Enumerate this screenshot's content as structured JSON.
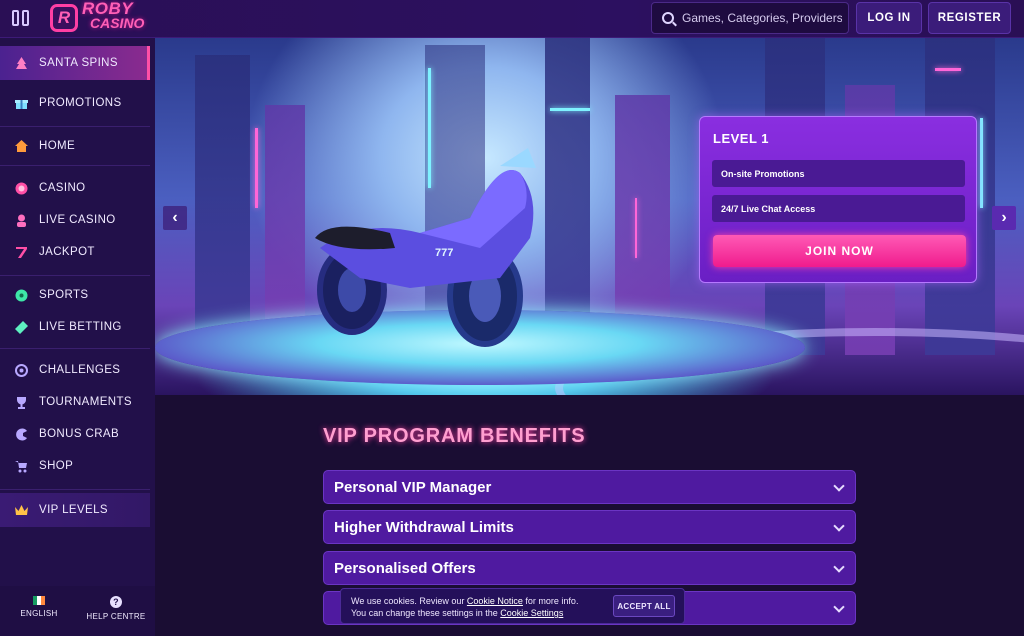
{
  "header": {
    "logo_main": "ROBY",
    "logo_sub": "CASINO",
    "logo_mark": "R",
    "search_placeholder": "Games, Categories, Providers",
    "login_label": "LOG IN",
    "register_label": "REGISTER"
  },
  "sidebar": {
    "items": [
      {
        "label": "SANTA SPINS",
        "icon": "christmas-tree-icon"
      },
      {
        "label": "PROMOTIONS",
        "icon": "gift-icon"
      },
      {
        "label": "HOME",
        "icon": "home-icon"
      },
      {
        "label": "CASINO",
        "icon": "chip-icon"
      },
      {
        "label": "LIVE CASINO",
        "icon": "dealer-icon"
      },
      {
        "label": "JACKPOT",
        "icon": "seven-icon"
      },
      {
        "label": "SPORTS",
        "icon": "football-icon"
      },
      {
        "label": "LIVE BETTING",
        "icon": "ticket-icon"
      },
      {
        "label": "CHALLENGES",
        "icon": "medal-icon"
      },
      {
        "label": "TOURNAMENTS",
        "icon": "trophy-icon"
      },
      {
        "label": "BONUS CRAB",
        "icon": "crab-icon"
      },
      {
        "label": "SHOP",
        "icon": "cart-icon"
      },
      {
        "label": "VIP LEVELS",
        "icon": "crown-icon"
      }
    ],
    "footer": {
      "language": "ENGLISH",
      "help": "HELP CENTRE",
      "help_glyph": "?"
    }
  },
  "hero": {
    "level_title": "LEVEL 1",
    "perks": [
      "On-site Promotions",
      "24/7 Live Chat Access"
    ],
    "join_label": "JOIN NOW",
    "prev_glyph": "‹",
    "next_glyph": "›",
    "bike_plate": "777"
  },
  "vip": {
    "title": "VIP PROGRAM BENEFITS",
    "benefits": [
      "Personal VIP Manager",
      "Higher Withdrawal Limits",
      "Personalised Offers",
      ""
    ]
  },
  "cookie": {
    "text1_a": "We use cookies. Review our ",
    "text1_link": "Cookie Notice",
    "text1_b": " for more info.",
    "text2_a": "You can change these settings in the ",
    "text2_link": "Cookie Settings",
    "accept_label": "ACCEPT ALL"
  },
  "colors": {
    "accent_pink": "#ff3fa4",
    "panel_purple": "#4f1aa0",
    "background": "#1a0d33"
  }
}
